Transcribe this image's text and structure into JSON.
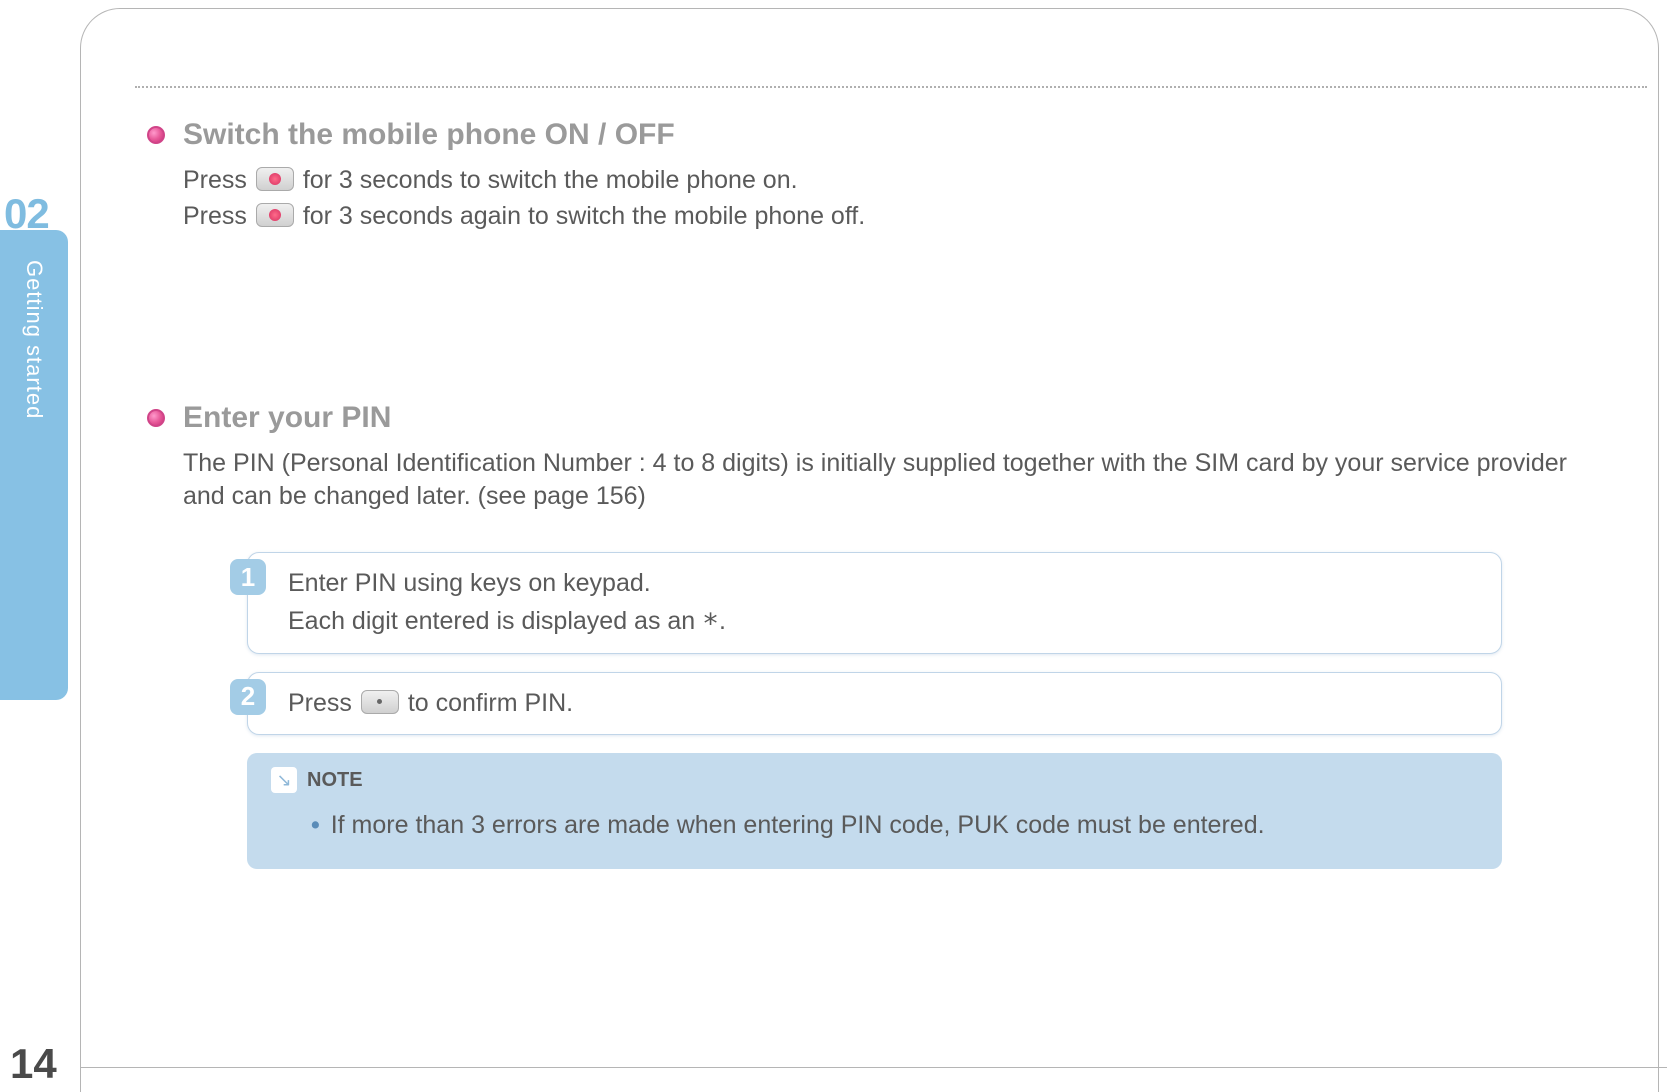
{
  "chapter": {
    "number": "02",
    "title": "Getting started",
    "page_number": "14"
  },
  "sections": {
    "switch": {
      "heading": "Switch the mobile phone ON / OFF",
      "line1_a": "Press ",
      "line1_b": " for 3 seconds to switch the mobile phone on.",
      "line2_a": "Press ",
      "line2_b": " for 3 seconds again to switch the mobile phone off."
    },
    "pin": {
      "heading": "Enter your PIN",
      "intro": "The PIN (Personal Identification Number : 4 to 8 digits) is initially supplied together with the SIM card by your service provider and can be changed later. (see page 156)",
      "steps": {
        "s1": {
          "num": "1",
          "line1": "Enter PIN using keys on keypad.",
          "line2_a": "Each digit entered is displayed as an ",
          "line2_star": "*",
          "line2_b": "."
        },
        "s2": {
          "num": "2",
          "a": "Press ",
          "b": " to confirm PIN."
        }
      },
      "note": {
        "label": "NOTE",
        "text": "If more than 3 errors are made when entering PIN code, PUK code must be entered."
      }
    }
  }
}
